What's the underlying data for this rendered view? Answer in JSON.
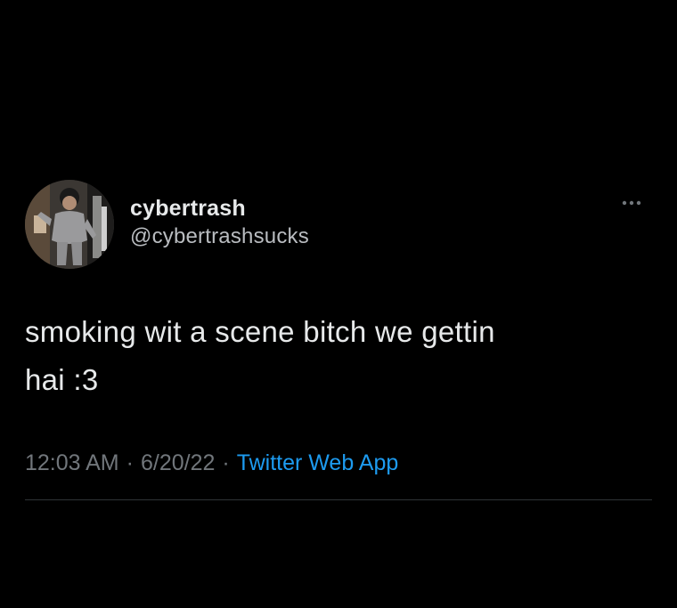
{
  "tweet": {
    "author": {
      "display_name": "cybertrash",
      "handle": "@cybertrashsucks",
      "avatar_icon": "user-avatar"
    },
    "more_icon": "more-horizontal-icon",
    "text": "smoking wit a scene bitch we gettin\nhai :3",
    "meta": {
      "time": "12:03 AM",
      "separator": "·",
      "date": "6/20/22",
      "source": "Twitter Web App"
    }
  },
  "colors": {
    "background": "#000000",
    "primary_text": "#e7e9ea",
    "secondary_text": "#71767b",
    "link": "#1d9bf0",
    "divider": "#2f3336"
  }
}
